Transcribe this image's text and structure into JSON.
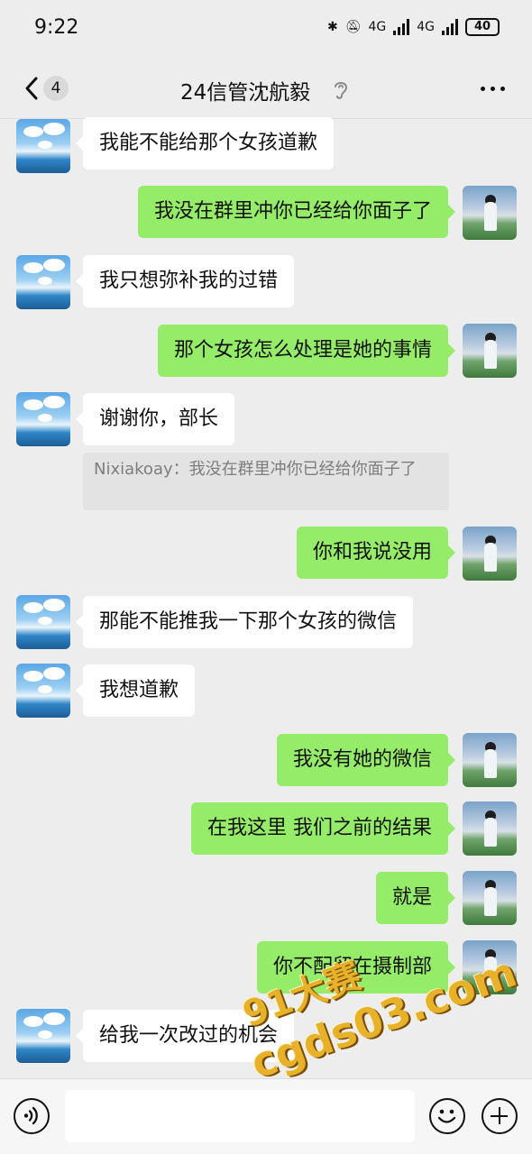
{
  "status_bar": {
    "time": "9:22",
    "network_1": "4G",
    "network_2": "4G",
    "battery": "40"
  },
  "header": {
    "back_badge": "4",
    "title": "24信管沈航毅",
    "icons": [
      "chevron-left-icon",
      "ear-icon",
      "more-icon"
    ]
  },
  "messages": [
    {
      "side": "in",
      "text": "我能不能给那个女孩道歉"
    },
    {
      "side": "out",
      "text": "我没在群里冲你已经给你面子了"
    },
    {
      "side": "in",
      "text": "我只想弥补我的过错"
    },
    {
      "side": "out",
      "text": "那个女孩怎么处理是她的事情"
    },
    {
      "side": "in",
      "text": "谢谢你，部长",
      "quote": "Nixiakoay：我没在群里冲你已经给你面子了"
    },
    {
      "side": "out",
      "text": "你和我说没用"
    },
    {
      "side": "in",
      "text": "那能不能推我一下那个女孩的微信"
    },
    {
      "side": "in",
      "text": "我想道歉"
    },
    {
      "side": "out",
      "text": "我没有她的微信"
    },
    {
      "side": "out",
      "text": "在我这里 我们之前的结果"
    },
    {
      "side": "out",
      "text": "就是"
    },
    {
      "side": "out",
      "text": "你不配留在摄制部"
    },
    {
      "side": "in",
      "text": "给我一次改过的机会"
    }
  ],
  "watermark": {
    "line1": "91大赛",
    "line2": "cgds03.com"
  },
  "input_bar": {
    "value": "",
    "icons": [
      "voice-icon",
      "emoji-icon",
      "plus-icon"
    ]
  }
}
